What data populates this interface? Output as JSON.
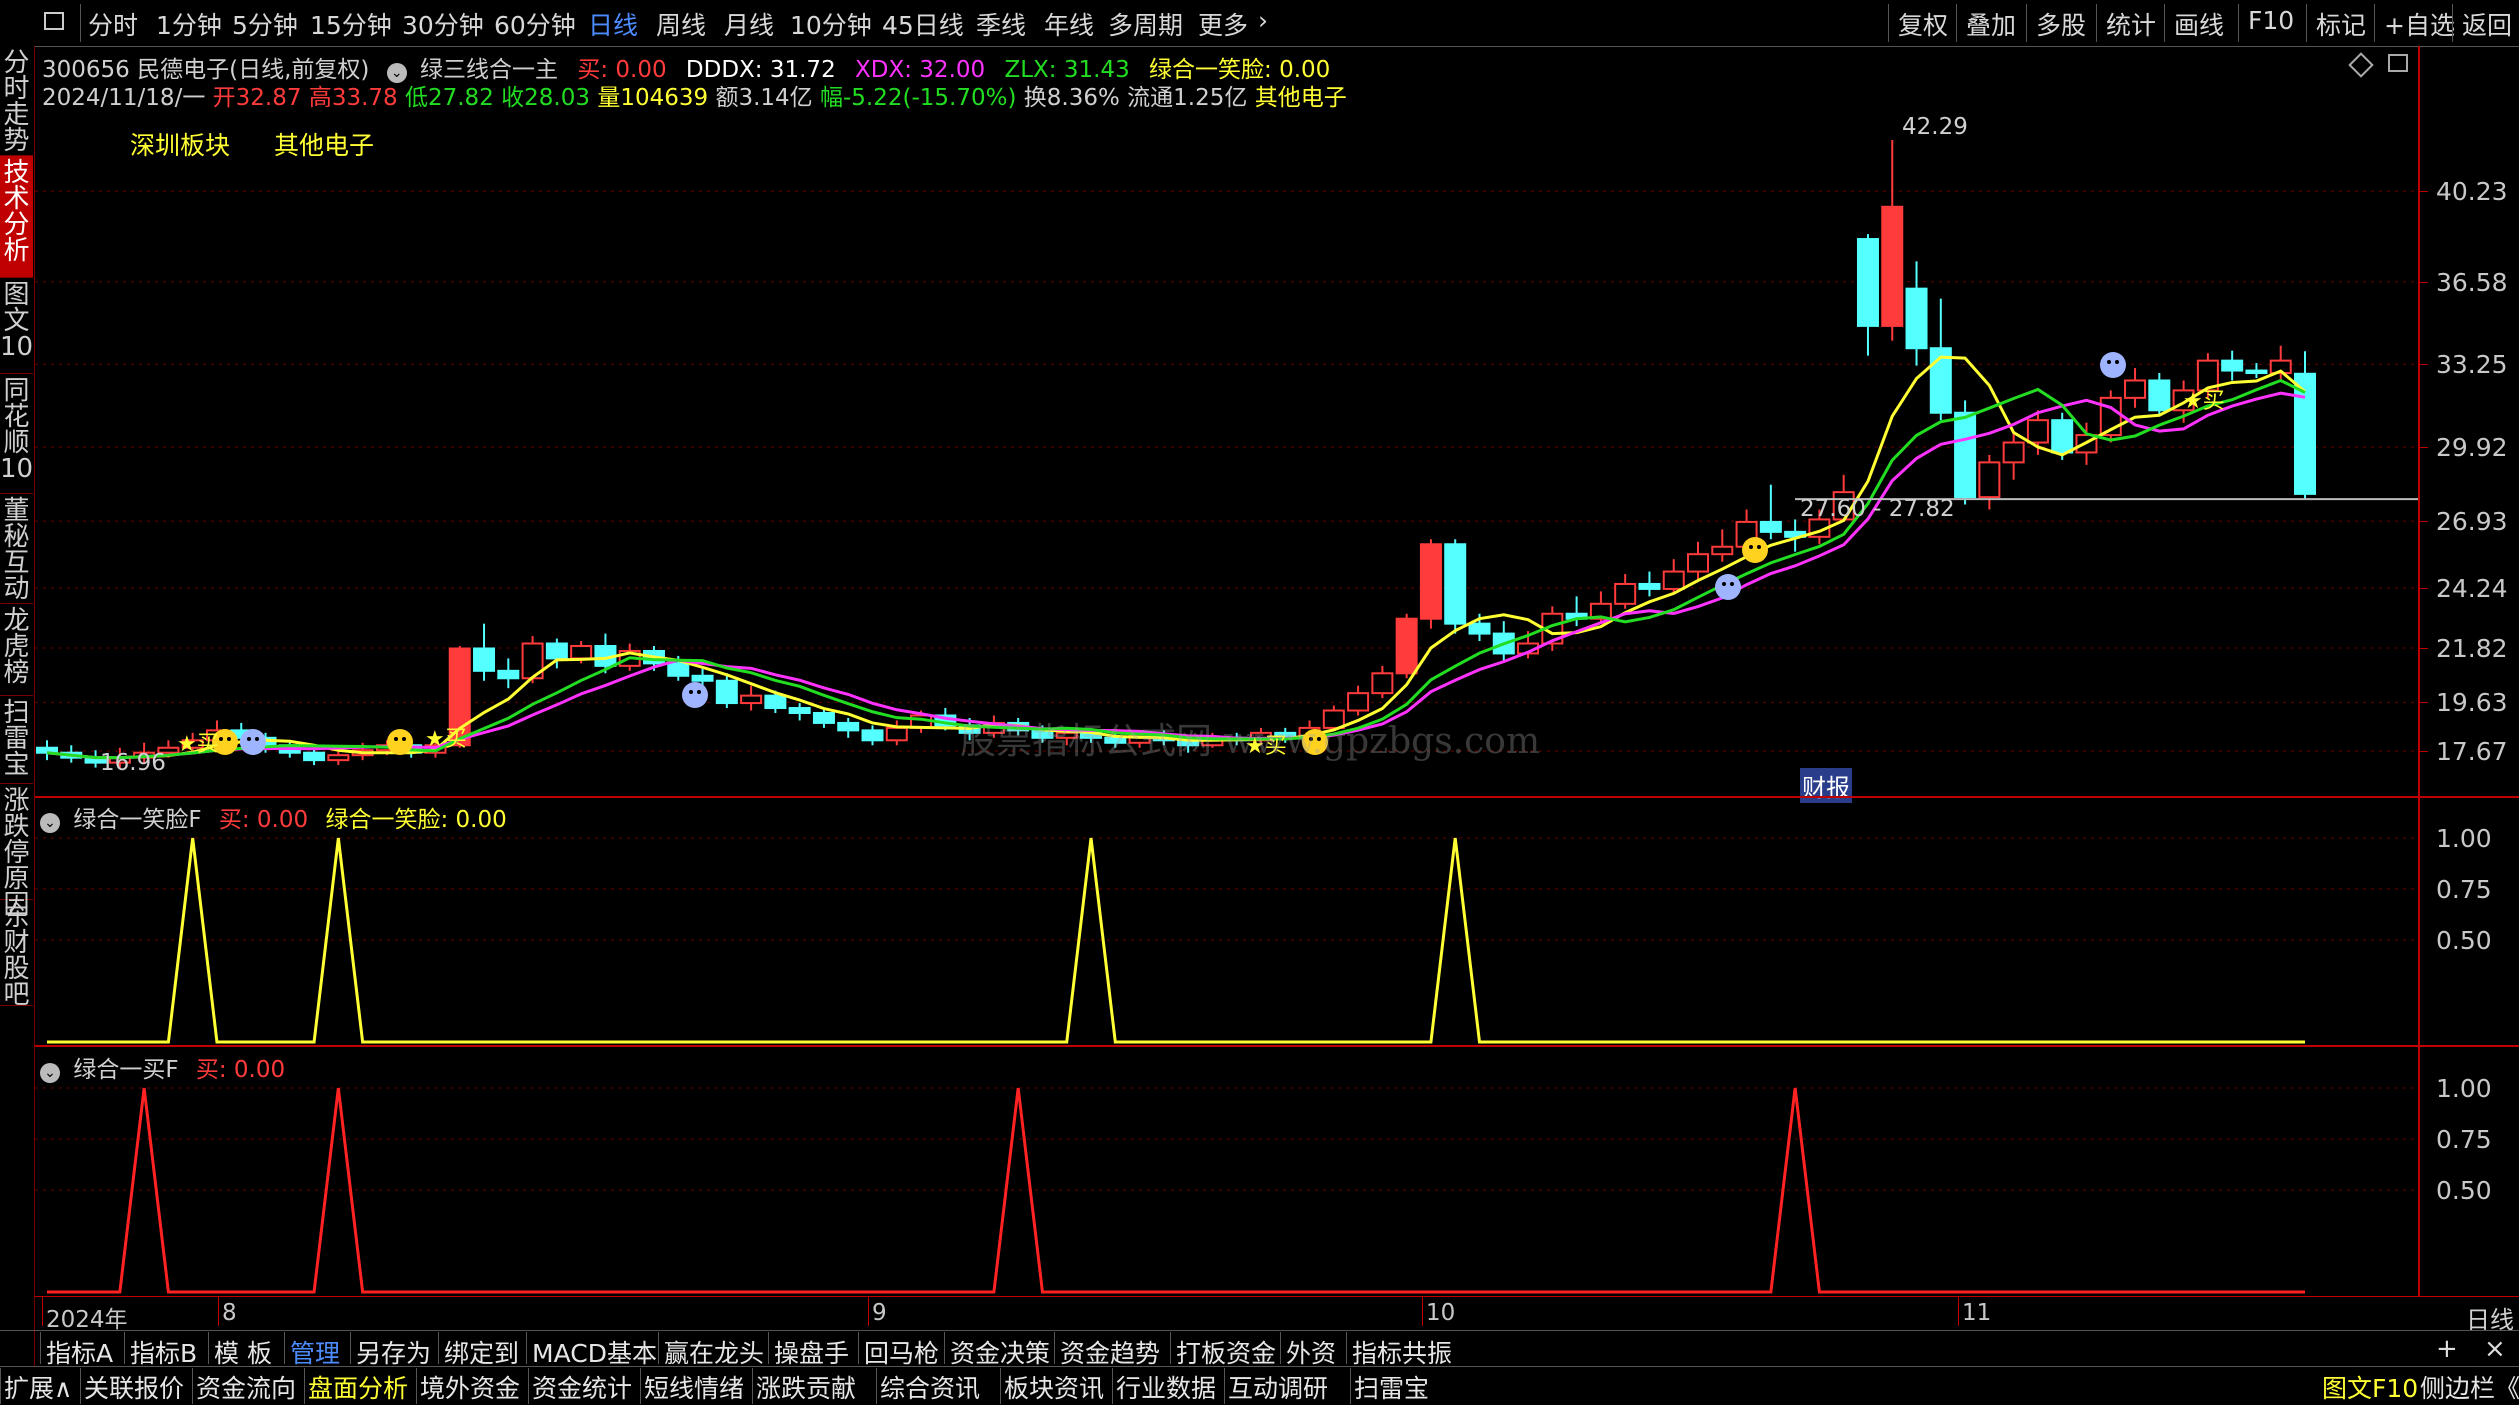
{
  "topbar": {
    "periods": [
      "分时",
      "1分钟",
      "5分钟",
      "15分钟",
      "30分钟",
      "60分钟",
      "日线",
      "周线",
      "月线",
      "10分钟",
      "45日线",
      "季线",
      "年线",
      "多周期",
      "更多"
    ],
    "active_period": "日线",
    "right_buttons": [
      "复权",
      "叠加",
      "多股",
      "统计",
      "画线",
      "F10",
      "标记",
      "+自选",
      "返回"
    ]
  },
  "left_tabs": [
    "分时走势",
    "技术分析",
    "图文10",
    "同花顺10",
    "董秘互动",
    "龙虎榜",
    "扫雷宝",
    "涨跌停原因",
    "东财股吧"
  ],
  "active_left_tab": "技术分析",
  "main": {
    "stock_line": "300656 民德电子(日线,前复权)",
    "indicator_name": "绿三线合一主",
    "buy_label": "买: 0.00",
    "dddx": "DDDX: 31.72",
    "xdx": "XDX: 32.00",
    "zlx": "ZLX: 31.43",
    "smile": "绿合一笑脸: 0.00",
    "date": "2024/11/18/一",
    "open": "开32.87",
    "high": "高33.78",
    "low": "低27.82",
    "close": "收28.03",
    "volume": "量104639",
    "amount": "额3.14亿",
    "change": "幅-5.22(-15.70%)",
    "turnover": "换8.36%",
    "float": "流通1.25亿",
    "industry": "其他电子",
    "sector1": "深圳板块",
    "sector2": "其他电子",
    "high_mark": "42.29",
    "low_mark": "16.96",
    "range_mark": "27.60 - 27.82",
    "caibao": "财报",
    "watermark": "股票指标公式网 www.gpzbgs.com",
    "buy_tag": "买",
    "y_ticks": [
      "40.23",
      "36.58",
      "33.25",
      "29.92",
      "26.93",
      "24.24",
      "21.82",
      "19.63",
      "17.67"
    ]
  },
  "sub1": {
    "name": "绿合一笑脸F",
    "buy": "买: 0.00",
    "value": "绿合一笑脸: 0.00",
    "y_ticks": [
      "1.00",
      "0.75",
      "0.50"
    ]
  },
  "sub2": {
    "name": "绿合一买F",
    "buy": "买: 0.00",
    "y_ticks": [
      "1.00",
      "0.75",
      "0.50"
    ]
  },
  "x_labels": [
    "2024年",
    "8",
    "9",
    "10",
    "11"
  ],
  "period_label": "日线",
  "bottom_tabs1": [
    "指标A",
    "指标B",
    "模 板",
    "管理",
    "另存为",
    "绑定到",
    "MACD基本",
    "赢在龙头",
    "操盘手",
    "回马枪",
    "资金决策",
    "资金趋势",
    "打板资金",
    "外资",
    "指标共振"
  ],
  "bottom_tabs2": [
    "扩展∧",
    "关联报价",
    "资金流向",
    "盘面分析",
    "境外资金",
    "资金统计",
    "短线情绪",
    "涨跌贡献",
    "综合资讯",
    "板块资讯",
    "行业数据",
    "互动调研",
    "扫雷宝"
  ],
  "bottom_right": [
    "图文F10",
    "侧边栏《"
  ],
  "colors": {
    "up": "#ff3b3b",
    "down": "#54ffff",
    "green": "#22dd22",
    "magenta": "#ff33ff",
    "yellow": "#ffff33",
    "grid": "#6a0000"
  },
  "chart_data": {
    "type": "candlestick",
    "candles": [
      [
        17.8,
        17.6,
        18.1,
        17.3
      ],
      [
        17.6,
        17.4,
        17.9,
        17.2
      ],
      [
        17.4,
        17.2,
        17.7,
        17.0
      ],
      [
        17.2,
        17.4,
        17.8,
        16.96
      ],
      [
        17.4,
        17.6,
        18.0,
        17.2
      ],
      [
        17.6,
        17.8,
        18.1,
        17.4
      ],
      [
        17.8,
        18.1,
        18.4,
        17.6
      ],
      [
        18.1,
        18.5,
        18.9,
        17.9
      ],
      [
        18.5,
        18.2,
        18.8,
        17.9
      ],
      [
        18.2,
        17.9,
        18.4,
        17.6
      ],
      [
        17.9,
        17.6,
        18.1,
        17.4
      ],
      [
        17.6,
        17.3,
        17.9,
        17.1
      ],
      [
        17.3,
        17.5,
        17.8,
        17.1
      ],
      [
        17.5,
        17.7,
        18.0,
        17.3
      ],
      [
        17.7,
        17.9,
        18.1,
        17.5
      ],
      [
        17.9,
        17.6,
        18.2,
        17.4
      ],
      [
        17.6,
        17.9,
        18.1,
        17.4
      ],
      [
        17.9,
        21.8,
        21.9,
        17.8
      ],
      [
        21.8,
        20.9,
        22.8,
        20.5
      ],
      [
        20.9,
        20.6,
        21.4,
        20.2
      ],
      [
        20.6,
        22.0,
        22.3,
        20.4
      ],
      [
        22.0,
        21.4,
        22.2,
        21.0
      ],
      [
        21.4,
        21.9,
        22.1,
        21.2
      ],
      [
        21.9,
        21.1,
        22.4,
        20.8
      ],
      [
        21.1,
        21.7,
        22.0,
        20.9
      ],
      [
        21.7,
        21.2,
        21.9,
        20.9
      ],
      [
        21.2,
        20.7,
        21.5,
        20.5
      ],
      [
        20.7,
        20.5,
        21.0,
        20.1
      ],
      [
        20.5,
        19.6,
        20.8,
        19.4
      ],
      [
        19.6,
        19.9,
        20.3,
        19.3
      ],
      [
        19.9,
        19.4,
        20.1,
        19.2
      ],
      [
        19.4,
        19.2,
        19.6,
        18.9
      ],
      [
        19.2,
        18.8,
        19.4,
        18.6
      ],
      [
        18.8,
        18.5,
        19.0,
        18.2
      ],
      [
        18.5,
        18.1,
        18.7,
        17.9
      ],
      [
        18.1,
        18.6,
        18.9,
        17.9
      ],
      [
        18.6,
        19.1,
        19.3,
        18.4
      ],
      [
        19.1,
        18.7,
        19.4,
        18.5
      ],
      [
        18.7,
        18.4,
        19.0,
        18.1
      ],
      [
        18.4,
        18.8,
        19.1,
        18.2
      ],
      [
        18.8,
        18.5,
        19.0,
        18.3
      ],
      [
        18.5,
        18.2,
        18.7,
        18.0
      ],
      [
        18.2,
        18.4,
        18.6,
        17.9
      ],
      [
        18.4,
        18.2,
        18.6,
        18.0
      ],
      [
        18.2,
        18.0,
        18.4,
        17.8
      ],
      [
        18.0,
        18.3,
        18.5,
        17.8
      ],
      [
        18.3,
        18.1,
        18.5,
        17.9
      ],
      [
        18.1,
        17.9,
        18.3,
        17.6
      ],
      [
        17.9,
        18.2,
        18.4,
        17.8
      ],
      [
        18.2,
        18.1,
        18.4,
        17.9
      ],
      [
        18.1,
        18.4,
        18.6,
        17.9
      ],
      [
        18.4,
        18.2,
        18.6,
        18.0
      ],
      [
        18.2,
        18.6,
        18.9,
        18.1
      ],
      [
        18.6,
        19.3,
        19.5,
        18.5
      ],
      [
        19.3,
        20.0,
        20.3,
        19.1
      ],
      [
        20.0,
        20.8,
        21.1,
        19.8
      ],
      [
        20.8,
        23.0,
        23.2,
        20.6
      ],
      [
        23.0,
        26.0,
        26.2,
        22.6
      ],
      [
        26.0,
        22.8,
        26.2,
        22.4
      ],
      [
        22.8,
        22.4,
        23.2,
        22.1
      ],
      [
        22.4,
        21.6,
        22.9,
        21.3
      ],
      [
        21.6,
        22.0,
        22.5,
        21.4
      ],
      [
        22.0,
        23.2,
        23.5,
        21.7
      ],
      [
        23.2,
        23.0,
        23.9,
        22.7
      ],
      [
        23.0,
        23.6,
        24.1,
        22.8
      ],
      [
        23.6,
        24.4,
        24.8,
        23.4
      ],
      [
        24.4,
        24.2,
        24.9,
        23.9
      ],
      [
        24.2,
        24.9,
        25.4,
        24.0
      ],
      [
        24.9,
        25.6,
        26.1,
        24.6
      ],
      [
        25.6,
        25.9,
        26.6,
        25.3
      ],
      [
        25.9,
        26.9,
        27.4,
        25.7
      ],
      [
        26.9,
        26.5,
        28.4,
        26.2
      ],
      [
        26.5,
        26.3,
        27.0,
        25.7
      ],
      [
        26.3,
        27.0,
        27.4,
        26.0
      ],
      [
        27.0,
        28.1,
        28.8,
        26.9
      ],
      [
        38.3,
        34.8,
        38.5,
        33.6
      ],
      [
        34.8,
        39.6,
        42.29,
        34.2
      ],
      [
        36.3,
        33.9,
        37.4,
        33.2
      ],
      [
        33.9,
        31.3,
        35.9,
        31.0
      ],
      [
        31.3,
        27.9,
        31.8,
        27.6
      ],
      [
        27.9,
        29.3,
        29.6,
        27.4
      ],
      [
        29.3,
        30.1,
        30.5,
        28.6
      ],
      [
        30.1,
        31.0,
        31.4,
        29.6
      ],
      [
        31.0,
        29.7,
        31.3,
        29.4
      ],
      [
        29.7,
        30.4,
        30.9,
        29.2
      ],
      [
        30.4,
        31.9,
        32.2,
        30.1
      ],
      [
        31.9,
        32.6,
        33.1,
        31.5
      ],
      [
        32.6,
        31.4,
        32.9,
        31.2
      ],
      [
        31.4,
        32.2,
        32.6,
        30.9
      ],
      [
        32.2,
        33.4,
        33.7,
        31.9
      ],
      [
        33.4,
        33.0,
        33.8,
        32.6
      ],
      [
        33.0,
        32.9,
        33.3,
        32.7
      ],
      [
        32.9,
        33.4,
        34.0,
        32.6
      ],
      [
        32.87,
        28.03,
        33.78,
        27.82
      ]
    ],
    "ylim": [
      16.5,
      43.5
    ]
  }
}
